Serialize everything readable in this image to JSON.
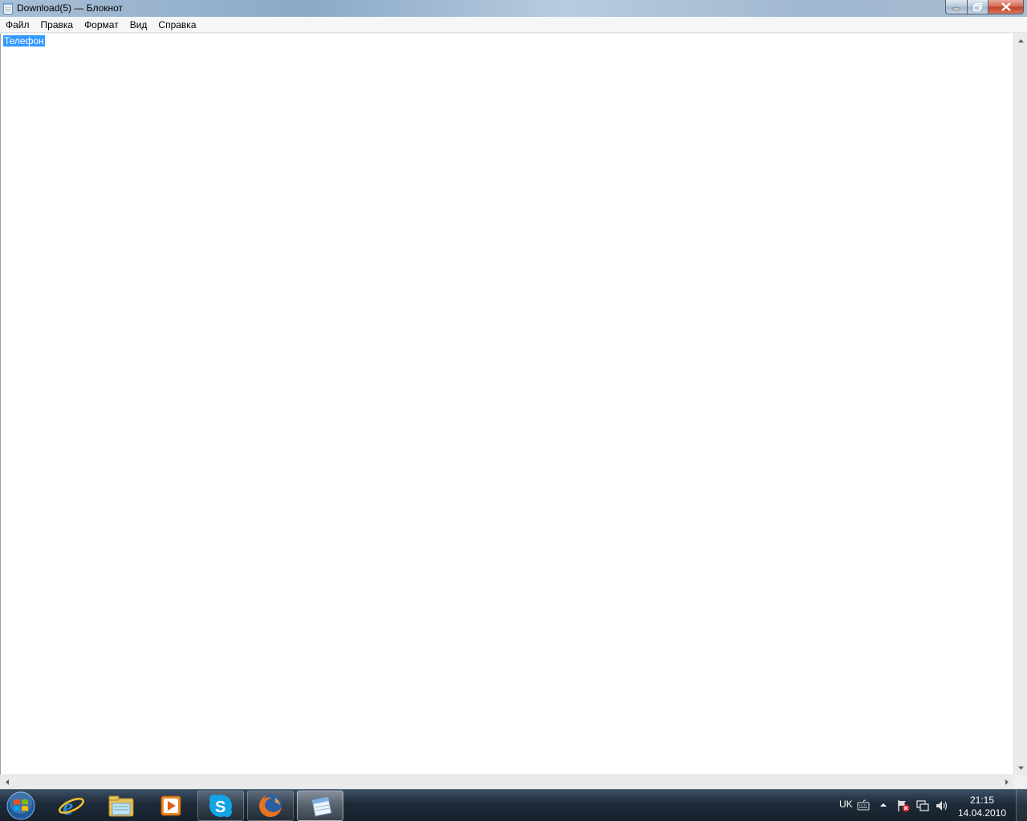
{
  "window": {
    "title": "Download(5) — Блокнот",
    "icon": "notepad-icon"
  },
  "menu": {
    "items": [
      {
        "label": "Файл"
      },
      {
        "label": "Правка"
      },
      {
        "label": "Формат"
      },
      {
        "label": "Вид"
      },
      {
        "label": "Справка"
      }
    ]
  },
  "editor": {
    "selected_text": "Телефон"
  },
  "taskbar": {
    "apps": [
      {
        "name": "internet-explorer-icon"
      },
      {
        "name": "windows-explorer-icon"
      },
      {
        "name": "media-player-icon"
      },
      {
        "name": "skype-icon"
      },
      {
        "name": "firefox-icon"
      },
      {
        "name": "notepad-icon"
      }
    ]
  },
  "tray": {
    "language": "UK",
    "time": "21:15",
    "date": "14.04.2010"
  },
  "colors": {
    "selection": "#3399ff",
    "taskbar": "#1d2a38",
    "close_button": "#c33f22"
  }
}
